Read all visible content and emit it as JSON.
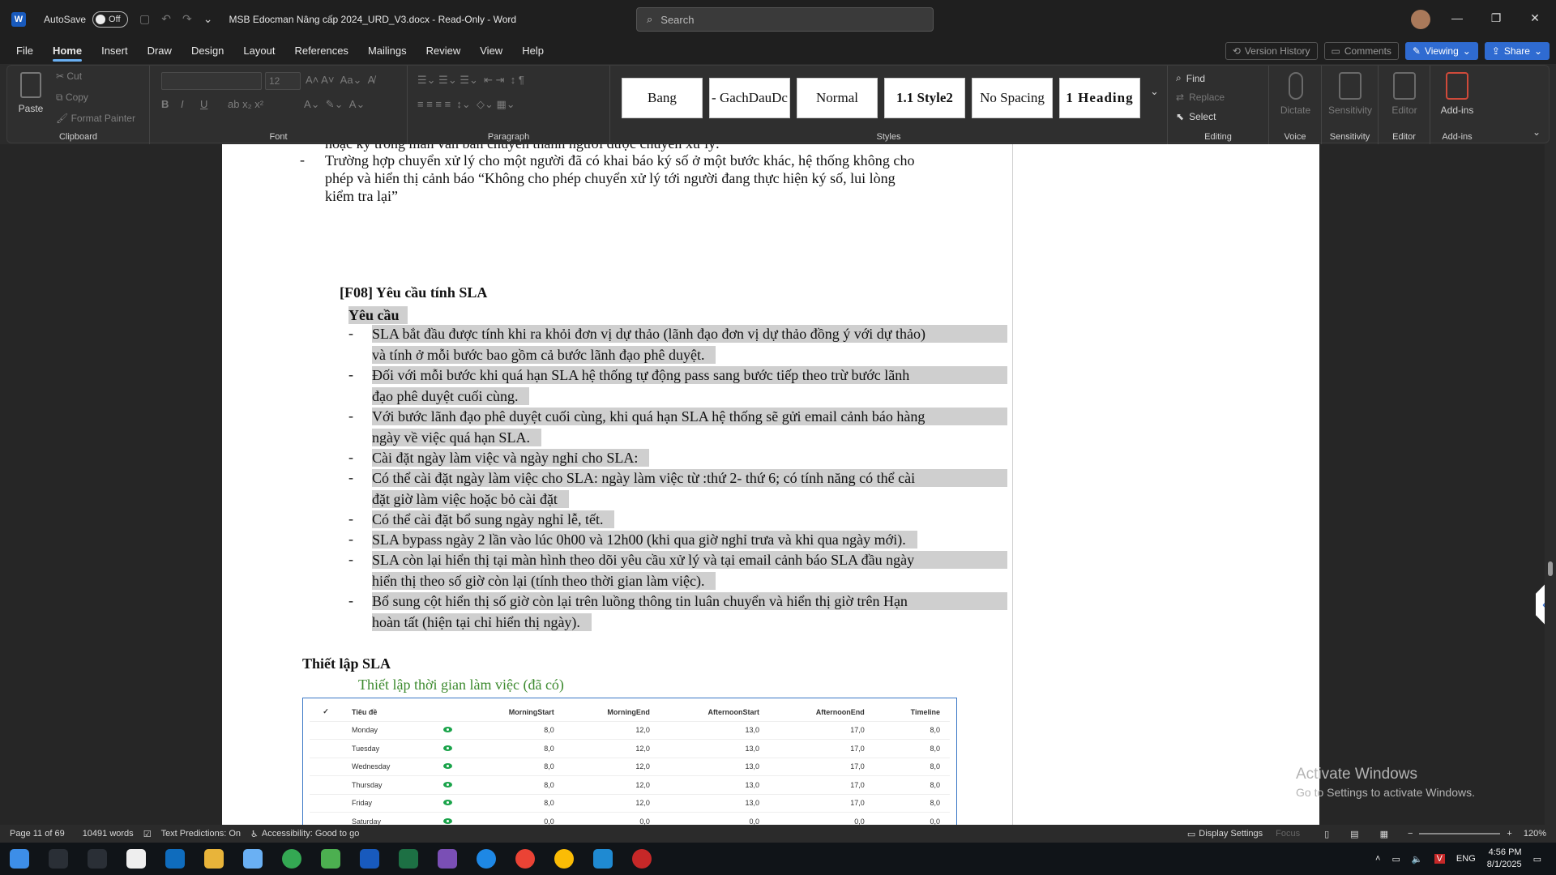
{
  "titlebar": {
    "autosave_label": "AutoSave",
    "autosave_state": "Off",
    "doc_title": "MSB Edocman Nâng cấp 2024_URD_V3.docx  -  Read-Only  -  Word",
    "search_placeholder": "Search"
  },
  "menu": {
    "items": [
      "File",
      "Home",
      "Insert",
      "Draw",
      "Design",
      "Layout",
      "References",
      "Mailings",
      "Review",
      "View",
      "Help"
    ],
    "active": "Home",
    "version_history": "Version History",
    "comments": "Comments",
    "viewing": "Viewing",
    "share": "Share"
  },
  "ribbon": {
    "clipboard": {
      "paste": "Paste",
      "cut": "Cut",
      "copy": "Copy",
      "format_painter": "Format Painter",
      "label": "Clipboard"
    },
    "font": {
      "size": "12",
      "label": "Font"
    },
    "paragraph": {
      "label": "Paragraph"
    },
    "styles": {
      "items": [
        "Bang",
        "-  GachDauDc",
        "Normal",
        "1.1  Style2",
        "No Spacing",
        "1  Heading"
      ],
      "label": "Styles"
    },
    "editing": {
      "find": "Find",
      "replace": "Replace",
      "select": "Select",
      "label": "Editing"
    },
    "voice": {
      "dictate": "Dictate",
      "label": "Voice"
    },
    "sensitivity": {
      "name": "Sensitivity",
      "label": "Sensitivity"
    },
    "editor": {
      "name": "Editor",
      "label": "Editor"
    },
    "addins": {
      "name": "Add-ins",
      "label": "Add-ins"
    }
  },
  "document": {
    "top_cut": "hoặc ký trong màn văn bản chuyển thành người được chuyển xử lý.",
    "bullet_a": [
      "Trường hợp chuyển xử lý cho một người đã có khai báo ký số ở một bước khác, hệ thống không cho",
      "phép và hiển thị cảnh báo “Không cho phép chuyển xử lý tới người đang thực hiện ký số, lui lòng",
      "kiểm tra lại”"
    ],
    "section_title": "[F08] Yêu cầu tính SLA",
    "req_heading": "Yêu cầu",
    "bullets": [
      [
        "SLA bắt đầu được tính khi ra khỏi đơn vị dự thảo (lãnh đạo đơn vị dự thảo đồng ý với dự thảo)",
        "và tính ở mỗi bước bao gồm cả bước lãnh đạo phê duyệt."
      ],
      [
        "Đối với mỗi bước khi quá hạn SLA hệ thống tự động pass sang bước tiếp theo trừ bước lãnh",
        "đạo phê duyệt cuối cùng."
      ],
      [
        "Với bước lãnh đạo phê duyệt cuối cùng, khi quá hạn SLA hệ thống sẽ gửi email cảnh báo hàng",
        "ngày về việc quá hạn SLA."
      ],
      [
        "Cài đặt ngày làm việc và ngày nghỉ cho SLA:"
      ],
      [
        "Có thể cài đặt ngày làm việc cho SLA: ngày làm việc từ :thứ 2- thứ 6; có tính năng có thể cài",
        "đặt giờ làm việc hoặc bỏ cài đặt"
      ],
      [
        "Có thể cài đặt bổ sung ngày nghỉ lễ, tết."
      ],
      [
        "SLA bypass ngày 2 lần vào lúc 0h00 và 12h00 (khi qua giờ nghỉ trưa và khi qua ngày mới)."
      ],
      [
        "SLA còn lại hiển thị tại màn hình theo dõi yêu cầu xử lý và tại email cảnh báo SLA đầu ngày",
        "hiển thị theo số giờ còn lại (tính theo thời gian làm việc)."
      ],
      [
        "Bổ sung cột hiển thị số giờ còn lại trên luồng thông tin luân chuyển và hiển thị giờ trên Hạn",
        "hoàn tất (hiện tại chỉ hiển thị ngày)."
      ]
    ],
    "setup_heading": "Thiết lập SLA",
    "setup_sub": "Thiết lập thời gian làm việc (đã có)",
    "table": {
      "headers": [
        "Tiêu đề",
        "",
        "MorningStart",
        "MorningEnd",
        "AfternoonStart",
        "AfternoonEnd",
        "Timeline"
      ],
      "rows": [
        [
          "Monday",
          "8,0",
          "12,0",
          "13,0",
          "17,0",
          "8,0"
        ],
        [
          "Tuesday",
          "8,0",
          "12,0",
          "13,0",
          "17,0",
          "8,0"
        ],
        [
          "Wednesday",
          "8,0",
          "12,0",
          "13,0",
          "17,0",
          "8,0"
        ],
        [
          "Thursday",
          "8,0",
          "12,0",
          "13,0",
          "17,0",
          "8,0"
        ],
        [
          "Friday",
          "8,0",
          "12,0",
          "13,0",
          "17,0",
          "8,0"
        ],
        [
          "Saturday",
          "0,0",
          "0,0",
          "0,0",
          "0,0",
          "0,0"
        ]
      ]
    }
  },
  "watermark": {
    "line1": "Activate Windows",
    "line2": "Go to Settings to activate Windows."
  },
  "status": {
    "page": "Page 11 of 69",
    "words": "10491 words",
    "predictions": "Text Predictions: On",
    "accessibility": "Accessibility: Good to go",
    "display_settings": "Display Settings",
    "focus": "Focus",
    "zoom": "120%"
  },
  "taskbar": {
    "lang": "ENG",
    "time": "4:56 PM",
    "date": "8/1/2025"
  },
  "colors": {
    "accent": "#2f6bd1",
    "highlight": "#cfcfcf",
    "green_text": "#3c8a2e"
  }
}
